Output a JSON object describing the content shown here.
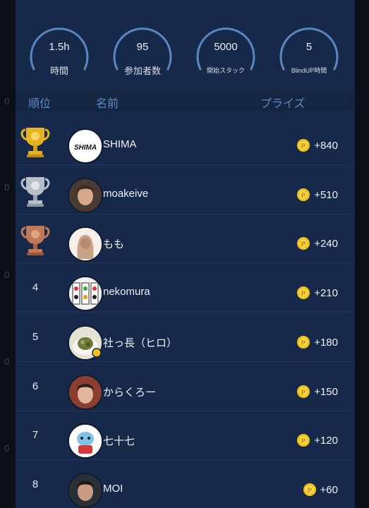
{
  "edge_marks": [
    "0",
    "0",
    "0",
    "0",
    "0"
  ],
  "stats": [
    {
      "value": "1.5h",
      "label": "時間"
    },
    {
      "value": "95",
      "label": "参加者数"
    },
    {
      "value": "5000",
      "label": "開始スタック"
    },
    {
      "value": "5",
      "label": "BlindUP時間"
    }
  ],
  "header": {
    "rank": "順位",
    "name": "名前",
    "prize": "プライズ"
  },
  "players": [
    {
      "rank": "1",
      "badge": "gold-trophy",
      "name": "SHIMA",
      "prize": "+840",
      "avatar_text": "SHIMA"
    },
    {
      "rank": "2",
      "badge": "silver-trophy",
      "name": "moakeive",
      "prize": "+510"
    },
    {
      "rank": "3",
      "badge": "bronze-trophy",
      "name": "もも",
      "prize": "+240"
    },
    {
      "rank": "4",
      "name": "nekomura",
      "prize": "+210"
    },
    {
      "rank": "5",
      "name": "社っ長（ヒロ）",
      "prize": "+180"
    },
    {
      "rank": "6",
      "name": "からくろー",
      "prize": "+150"
    },
    {
      "rank": "7",
      "name": "七十七",
      "prize": "+120"
    },
    {
      "rank": "8",
      "name": "MOI",
      "prize": "+60"
    }
  ],
  "colors": {
    "panel": "#17294a",
    "accent": "#5d87c5",
    "coin": "#f2c21b",
    "gold": "#e6b422",
    "silver": "#b8bfc9",
    "bronze": "#c27a56"
  }
}
